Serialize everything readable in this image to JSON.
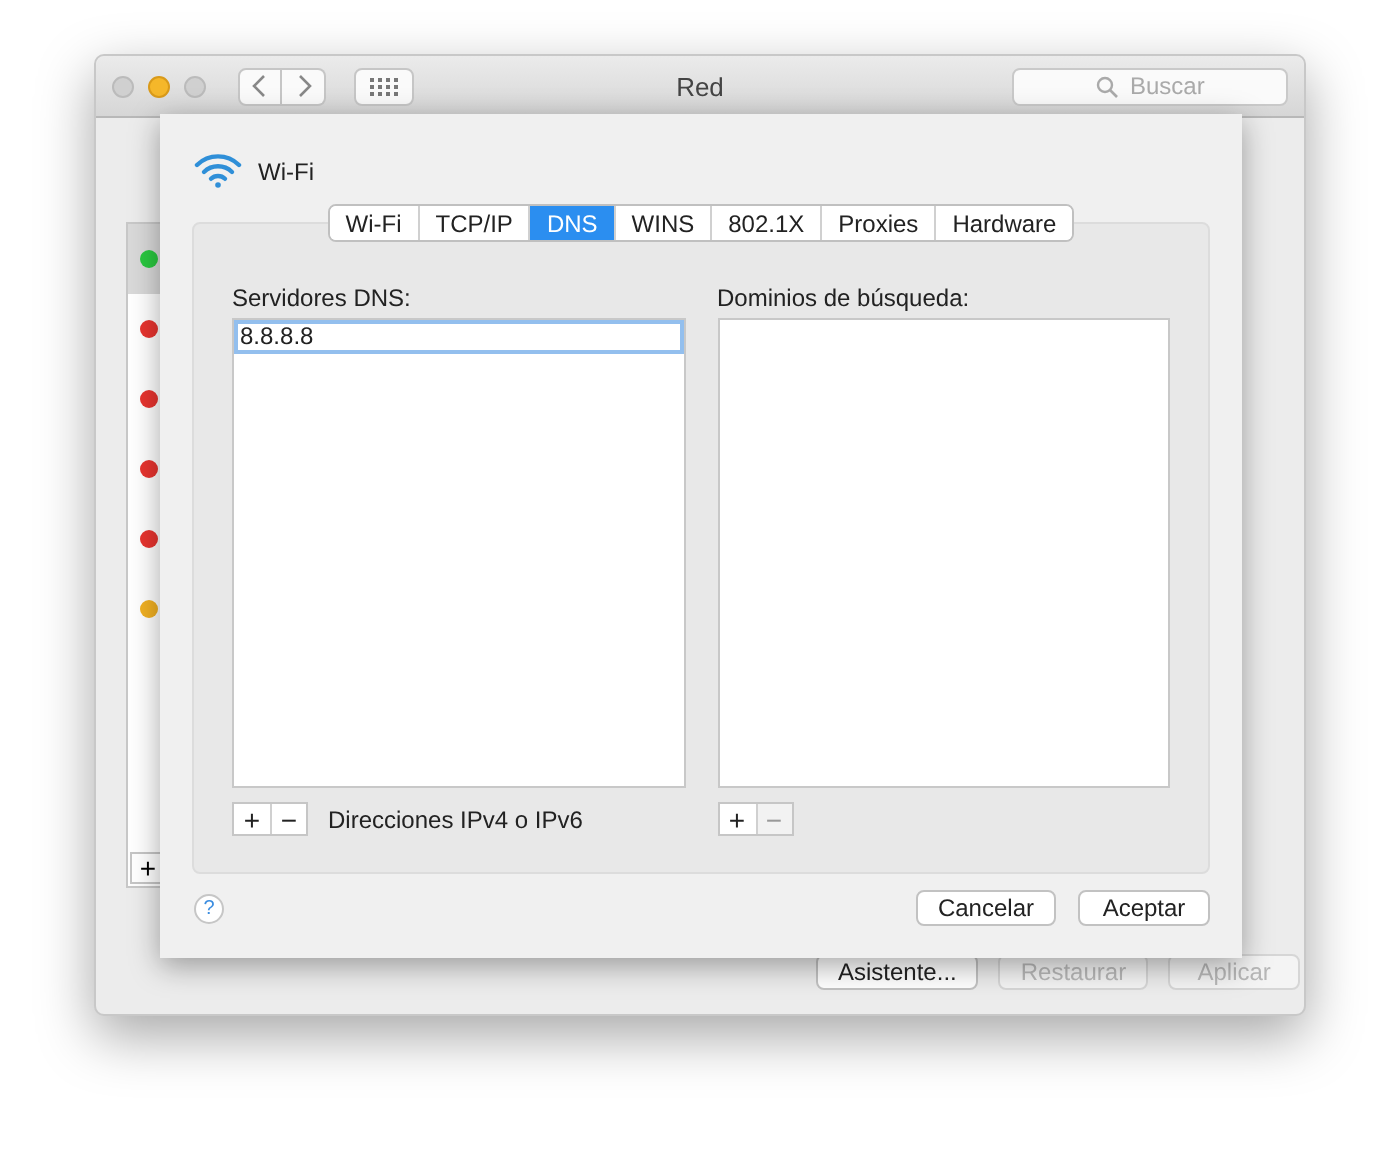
{
  "window": {
    "title": "Red",
    "search": {
      "placeholder": "Buscar"
    }
  },
  "sidebar": {
    "services": [
      {
        "color": "#2ac840",
        "selected": true
      },
      {
        "color": "#e8342f",
        "selected": false
      },
      {
        "color": "#e8342f",
        "selected": false
      },
      {
        "color": "#e8342f",
        "selected": false
      },
      {
        "color": "#e8342f",
        "selected": false
      },
      {
        "color": "#f2b122",
        "selected": false
      }
    ],
    "add_button": "+"
  },
  "buttons": [
    {
      "label": "Asistente...",
      "disabled": false
    },
    {
      "label": "Restaurar",
      "disabled": true
    },
    {
      "label": "Aplicar",
      "disabled": true
    }
  ],
  "sheet": {
    "title": "Wi-Fi",
    "tabs": [
      {
        "label": "Wi-Fi",
        "selected": false
      },
      {
        "label": "TCP/IP",
        "selected": false
      },
      {
        "label": "DNS",
        "selected": true
      },
      {
        "label": "WINS",
        "selected": false
      },
      {
        "label": "802.1X",
        "selected": false
      },
      {
        "label": "Proxies",
        "selected": false
      },
      {
        "label": "Hardware",
        "selected": false
      }
    ],
    "dns_servers": {
      "label": "Servidores DNS:",
      "entries": [
        {
          "value": "8.8.8.8",
          "selected": true
        }
      ],
      "add": "+",
      "remove": "−",
      "remove_disabled": false,
      "hint": "Direcciones IPv4 o IPv6"
    },
    "search_domains": {
      "label": "Dominios de búsqueda:",
      "add": "+",
      "remove": "−",
      "remove_disabled": true
    },
    "help": "?",
    "buttons": [
      {
        "label": "Cancelar"
      },
      {
        "label": "Aceptar"
      }
    ]
  }
}
